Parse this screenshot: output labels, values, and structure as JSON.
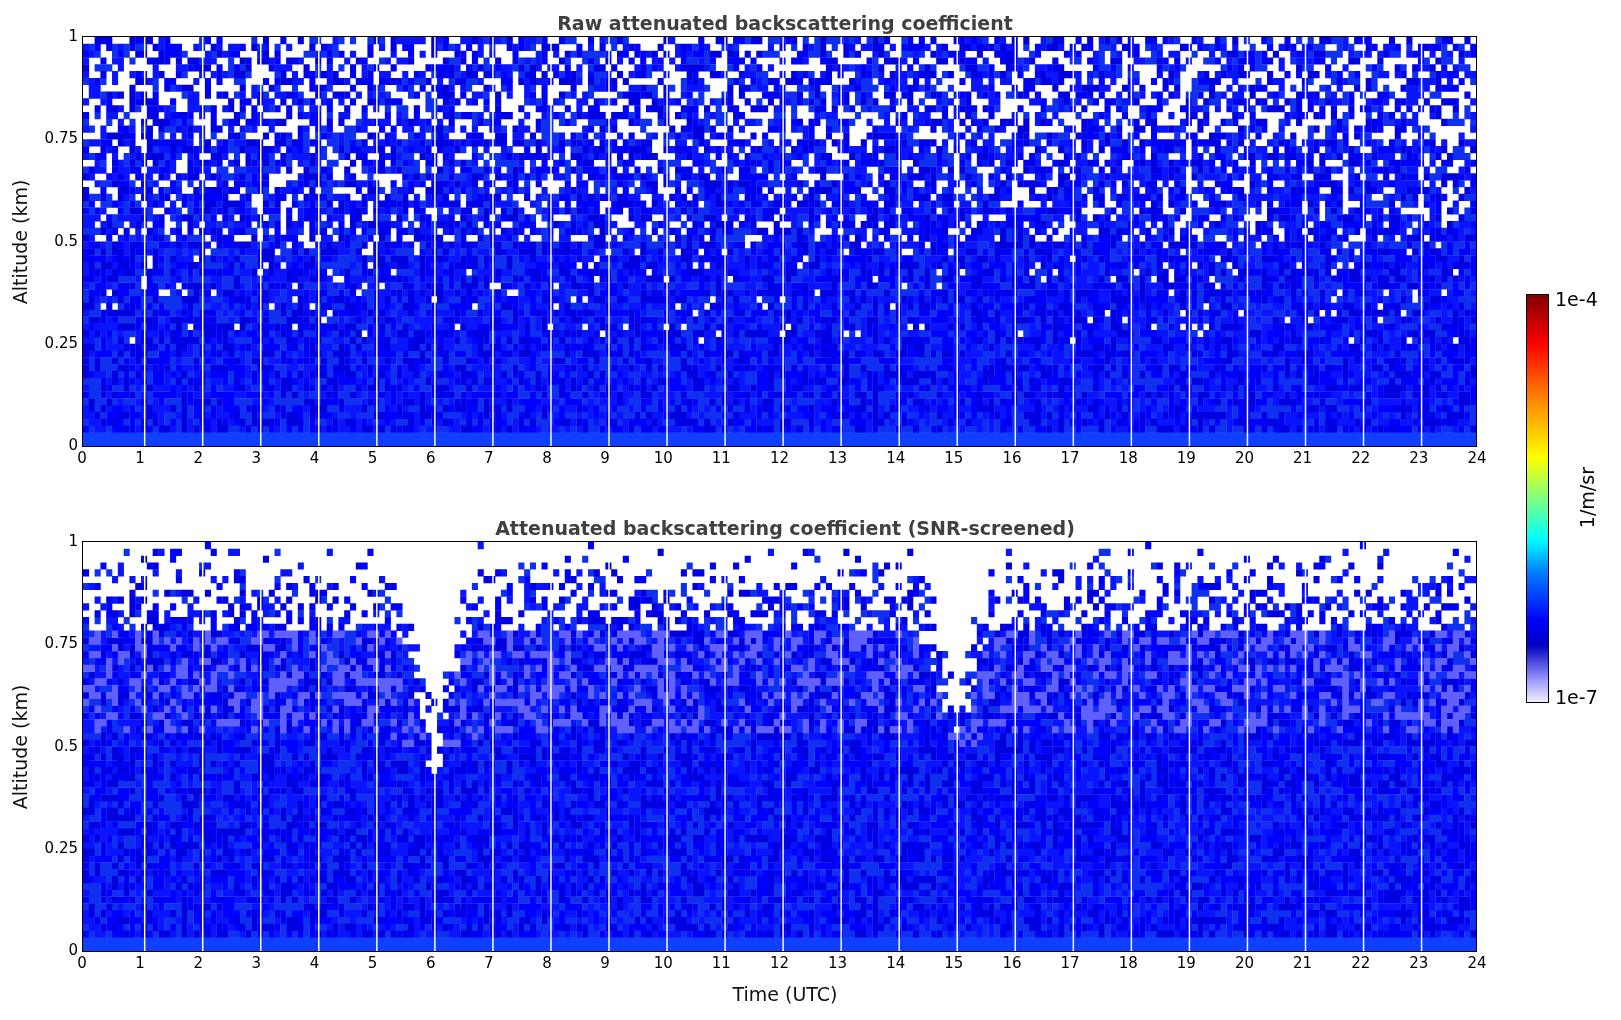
{
  "panels": [
    {
      "kind": "raw",
      "title": "Raw attenuated backscattering coefficient",
      "ylabel": "Altitude (km)",
      "yticks": [
        "1",
        "0.75",
        "0.5",
        "0.25",
        "0"
      ],
      "xticks": [
        "0",
        "1",
        "2",
        "3",
        "4",
        "5",
        "6",
        "7",
        "8",
        "9",
        "10",
        "11",
        "12",
        "13",
        "14",
        "15",
        "16",
        "17",
        "18",
        "19",
        "20",
        "21",
        "22",
        "23",
        "24"
      ]
    },
    {
      "kind": "screened",
      "title": "Attenuated backscattering coefficient (SNR-screened)",
      "ylabel": "Altitude (km)",
      "yticks": [
        "1",
        "0.75",
        "0.5",
        "0.25",
        "0"
      ],
      "xticks": [
        "0",
        "1",
        "2",
        "3",
        "4",
        "5",
        "6",
        "7",
        "8",
        "9",
        "10",
        "11",
        "12",
        "13",
        "14",
        "15",
        "16",
        "17",
        "18",
        "19",
        "20",
        "21",
        "22",
        "23",
        "24"
      ]
    }
  ],
  "xlabel": "Time (UTC)",
  "colorbar": {
    "max": "1e-4",
    "min": "1e-7",
    "unit": "1/m/sr"
  }
}
